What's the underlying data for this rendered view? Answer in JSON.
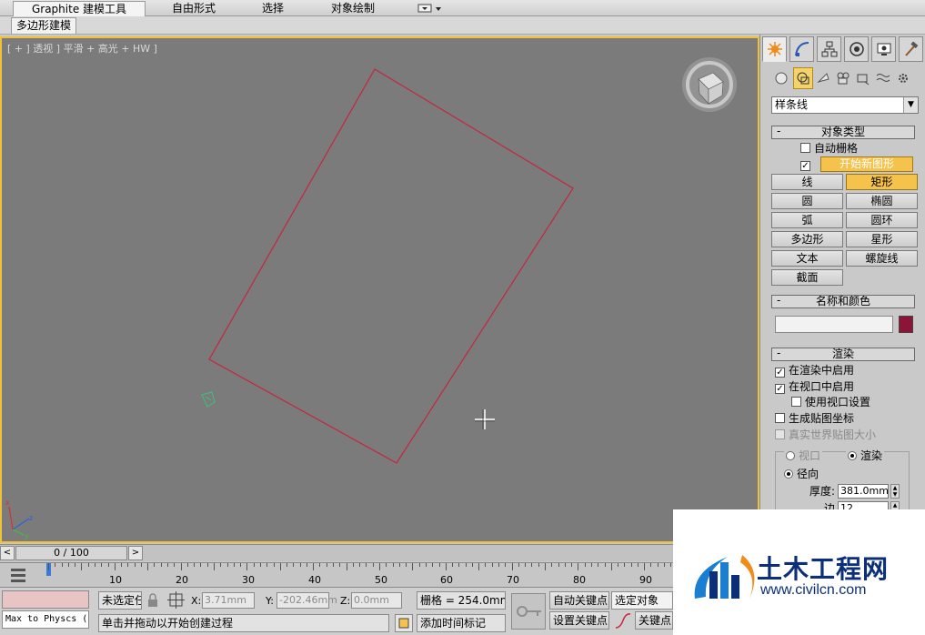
{
  "ribbon": {
    "tabs": [
      {
        "label": "Graphite 建模工具",
        "active": true
      },
      {
        "label": "自由形式"
      },
      {
        "label": "选择"
      },
      {
        "label": "对象绘制"
      }
    ],
    "subtab": "多边形建模"
  },
  "viewport": {
    "label": "[ + ] 透视 ] 平滑 + 高光 + HW ]"
  },
  "command_panel": {
    "category_dropdown": "样条线",
    "object_type": {
      "title": "对象类型",
      "auto_grid": "自动栅格",
      "start_new_shape": "开始新图形",
      "buttons": [
        "线",
        "矩形",
        "圆",
        "椭圆",
        "弧",
        "圆环",
        "多边形",
        "星形",
        "文本",
        "螺旋线",
        "截面"
      ],
      "active_button": "矩形"
    },
    "name_and_color": {
      "title": "名称和颜色",
      "name_value": "",
      "color": "#8c1436"
    },
    "rendering": {
      "title": "渲染",
      "enable_in_renderer": "在渲染中启用",
      "enable_in_viewport": "在视口中启用",
      "use_viewport_settings": "使用视口设置",
      "generate_mapping_coords": "生成贴图坐标",
      "real_world_map_size": "真实世界贴图大小",
      "viewport_radio": "视口",
      "render_radio": "渲染",
      "radial": "径向",
      "thickness_label": "厚度:",
      "thickness_value": "381.0mm",
      "sides_label": "边",
      "sides_value": "12"
    }
  },
  "timeline": {
    "frame_display": "0 / 100",
    "prev": "<",
    "next": ">",
    "ticks": [
      "10",
      "20",
      "30",
      "40",
      "50",
      "60",
      "70",
      "80",
      "90"
    ]
  },
  "status": {
    "script_listener": "Max to Physcs (",
    "selection": "未选定任",
    "x_label": "X:",
    "x_value": "3.71mm",
    "y_label": "Y:",
    "y_value": "-202.46mm",
    "z_label": "Z:",
    "z_value": "0.0mm",
    "grid": "栅格 = 254.0mm",
    "prompt": "单击并拖动以开始创建过程",
    "add_time_tag": "添加时间标记",
    "auto_key": "自动关键点",
    "set_key": "设置关键点",
    "selected_object": "选定对象",
    "key_filters": "关键点"
  },
  "watermark": {
    "title": "土木工程网",
    "url": "www.civilcn.com"
  },
  "colors": {
    "accent": "#f5c24c",
    "viewport_bg": "#7b7b7b",
    "shape_stroke": "#c4263f"
  }
}
